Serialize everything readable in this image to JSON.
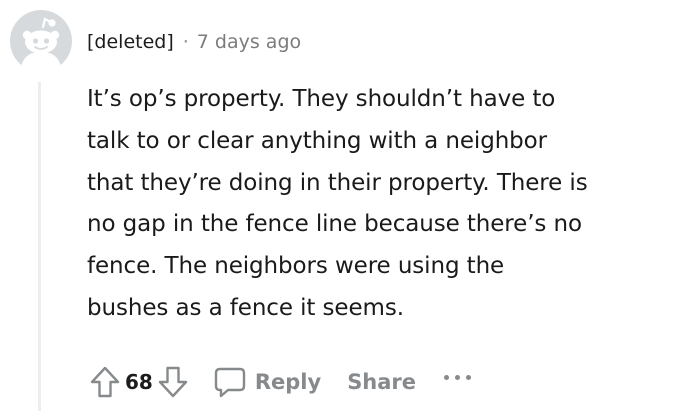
{
  "comment": {
    "author": "[deleted]",
    "separator": "·",
    "timestamp": "7 days ago",
    "body_lines": [
      "It’s op’s property. They shouldn’t have to",
      "talk to or clear anything with a neighbor",
      "that they’re doing in their property. There is",
      "no gap in the fence line because there’s no",
      "fence. The neighbors were using the",
      "bushes as a fence it seems."
    ],
    "score": "68",
    "reply_label": "Reply",
    "share_label": "Share",
    "more_label": "•••"
  },
  "icons": {
    "avatar": "snoo-avatar-icon",
    "upvote": "upvote-arrow-icon",
    "downvote": "downvote-arrow-icon",
    "reply": "comment-bubble-icon",
    "more": "more-options-icon"
  },
  "colors": {
    "text": "#1c1c1c",
    "meta": "#7c7c7c",
    "action": "#878a8c",
    "thread_line": "#eeeeee",
    "avatar_bg": "#d7dadc"
  }
}
